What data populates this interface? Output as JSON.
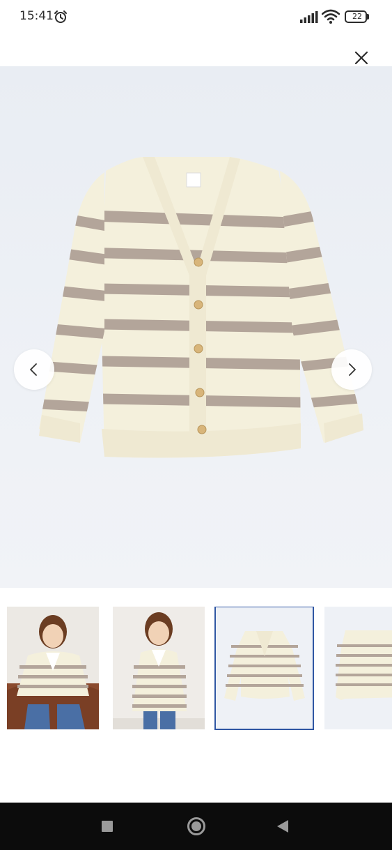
{
  "status_bar": {
    "time": "15:41",
    "battery_level": "22",
    "icons": [
      "alarm-icon",
      "signal-icon",
      "wifi-icon",
      "battery-icon"
    ]
  },
  "viewer": {
    "close_icon": "close-icon",
    "prev_icon": "chevron-left-icon",
    "next_icon": "chevron-right-icon",
    "selected_thumbnail": 3,
    "thumbnail_count_visible": 4
  },
  "colors": {
    "garment_cream": "#f4f0dc",
    "stripe_taupe": "#b3a59a",
    "button_wood": "#d8b57a",
    "selected_border": "#2f56a3",
    "background": "#eef1f6"
  },
  "nav_bar": {
    "icons": [
      "recents-icon",
      "home-icon",
      "back-icon"
    ]
  }
}
